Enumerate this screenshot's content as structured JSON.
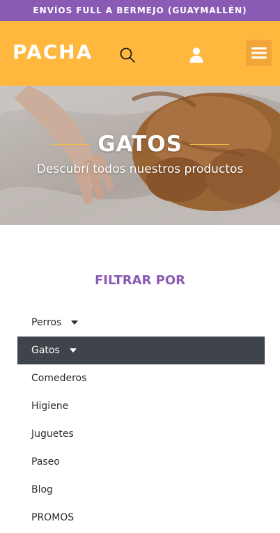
{
  "announcement": {
    "text": "ENVÍOS FULL A BERMEJO (GUAYMALLÉN)"
  },
  "header": {
    "logo": "PACHA",
    "search_icon": "search-icon",
    "user_icon": "user-icon",
    "menu_icon": "hamburger-menu-icon"
  },
  "hero": {
    "title": "GATOS",
    "subtitle": "Descubrí todos nuestros productos"
  },
  "filter": {
    "title": "FILTRAR POR",
    "items": [
      {
        "label": "Perros",
        "has_submenu": true,
        "active": false
      },
      {
        "label": "Gatos",
        "has_submenu": true,
        "active": true
      },
      {
        "label": "Comederos",
        "has_submenu": false,
        "active": false
      },
      {
        "label": "Higiene",
        "has_submenu": false,
        "active": false
      },
      {
        "label": "Juguetes",
        "has_submenu": false,
        "active": false
      },
      {
        "label": "Paseo",
        "has_submenu": false,
        "active": false
      },
      {
        "label": "Blog",
        "has_submenu": false,
        "active": false
      },
      {
        "label": "PROMOS",
        "has_submenu": false,
        "active": false
      }
    ]
  },
  "colors": {
    "announcement_bg": "#8a5bb5",
    "header_bg": "#ffb83d",
    "accent_purple": "#8a5bb5",
    "active_item_bg": "#3f444b",
    "hero_line": "#f2c141"
  }
}
